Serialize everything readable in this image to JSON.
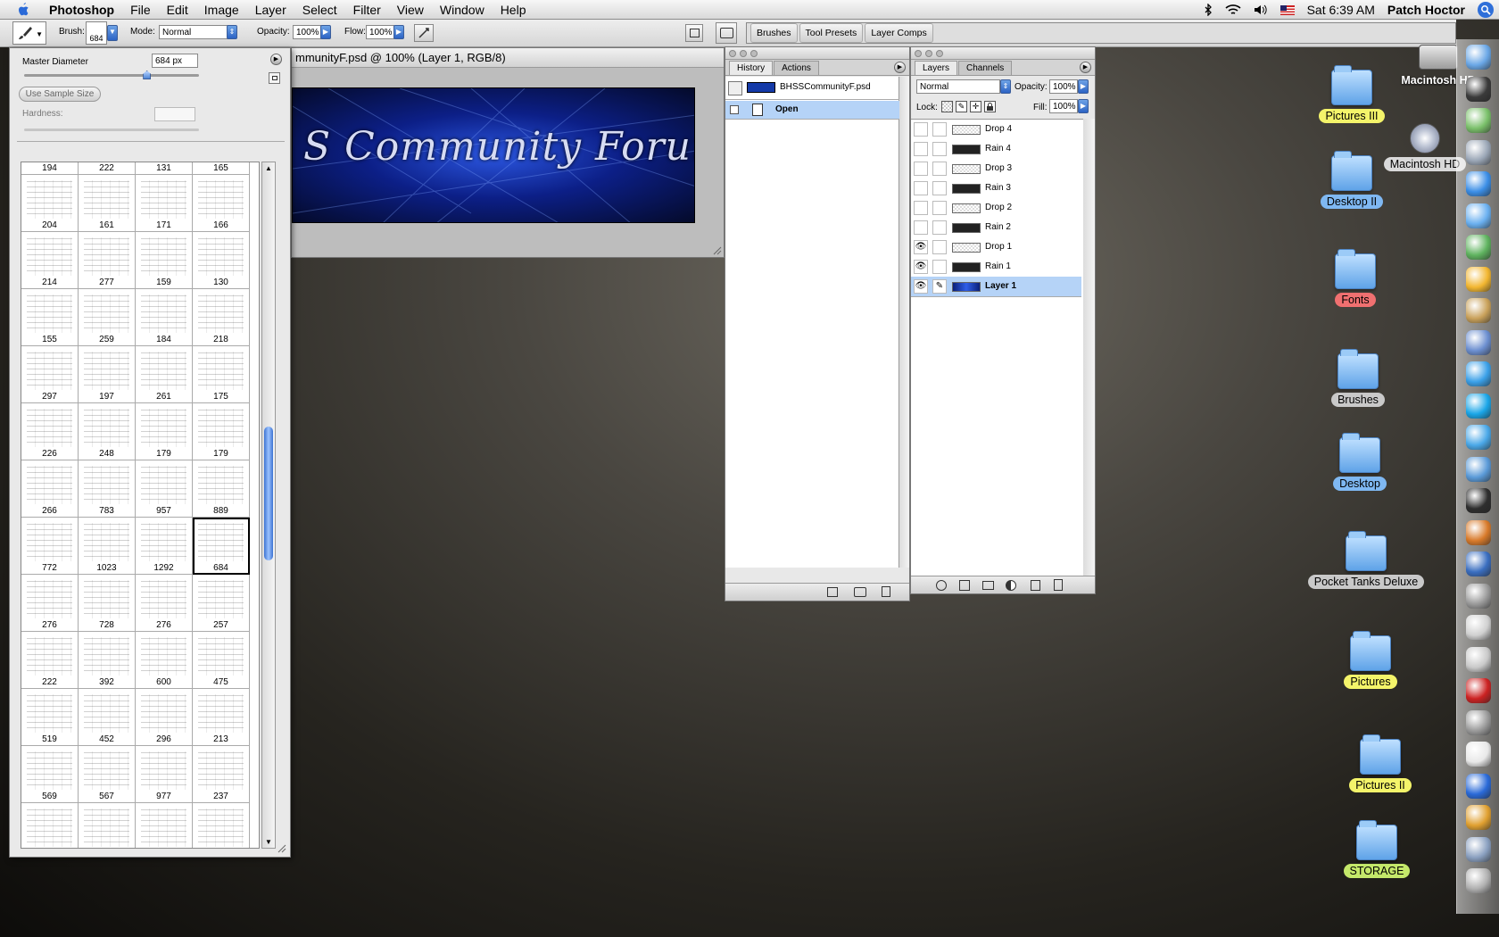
{
  "menubar": {
    "apple": "",
    "app_name": "Photoshop",
    "items": [
      "File",
      "Edit",
      "Image",
      "Layer",
      "Select",
      "Filter",
      "View",
      "Window",
      "Help"
    ],
    "clock": "Sat 6:39 AM",
    "user": "Patch Hoctor"
  },
  "options_bar": {
    "brush_label": "Brush:",
    "brush_size": "684",
    "mode_label": "Mode:",
    "mode_value": "Normal",
    "opacity_label": "Opacity:",
    "opacity_value": "100%",
    "flow_label": "Flow:",
    "flow_value": "100%",
    "well_tabs": [
      "Brushes",
      "Tool Presets",
      "Layer Comps"
    ]
  },
  "brush_picker": {
    "master_diameter_label": "Master Diameter",
    "master_diameter_value": "684 px",
    "slider_fraction": 0.7,
    "use_sample_size": "Use Sample Size",
    "hardness_label": "Hardness:",
    "hardness_value": "",
    "selected_brush": "684",
    "top_row": [
      "194",
      "222",
      "131",
      "165"
    ],
    "rows": [
      [
        "204",
        "161",
        "171",
        "166"
      ],
      [
        "214",
        "277",
        "159",
        "130"
      ],
      [
        "155",
        "259",
        "184",
        "218"
      ],
      [
        "297",
        "197",
        "261",
        "175"
      ],
      [
        "226",
        "248",
        "179",
        "179"
      ],
      [
        "266",
        "783",
        "957",
        "889"
      ],
      [
        "772",
        "1023",
        "1292",
        "684"
      ],
      [
        "276",
        "728",
        "276",
        "257"
      ],
      [
        "222",
        "392",
        "600",
        "475"
      ],
      [
        "519",
        "452",
        "296",
        "213"
      ],
      [
        "569",
        "567",
        "977",
        "237"
      ],
      [
        "",
        "",
        "",
        ""
      ]
    ]
  },
  "document": {
    "title": "mmunityF.psd @ 100% (Layer 1, RGB/8)",
    "banner_text": "S Community Forum"
  },
  "history_panel": {
    "tabs": [
      "History",
      "Actions"
    ],
    "snapshot_name": "BHSSCommunityF.psd",
    "states": [
      "Open"
    ]
  },
  "layers_panel": {
    "tabs": [
      "Layers",
      "Channels"
    ],
    "blend_mode": "Normal",
    "opacity_label": "Opacity:",
    "opacity_value": "100%",
    "lock_label": "Lock:",
    "fill_label": "Fill:",
    "fill_value": "100%",
    "layers": [
      {
        "name": "Drop 4",
        "visible": false,
        "thumb": "drop"
      },
      {
        "name": "Rain 4",
        "visible": false,
        "thumb": "rain"
      },
      {
        "name": "Drop 3",
        "visible": false,
        "thumb": "drop"
      },
      {
        "name": "Rain 3",
        "visible": false,
        "thumb": "rain"
      },
      {
        "name": "Drop 2",
        "visible": false,
        "thumb": "drop"
      },
      {
        "name": "Rain 2",
        "visible": false,
        "thumb": "rain"
      },
      {
        "name": "Drop 1",
        "visible": true,
        "thumb": "drop"
      },
      {
        "name": "Rain 1",
        "visible": true,
        "thumb": "rain"
      },
      {
        "name": "Layer 1",
        "visible": true,
        "thumb": "banner",
        "selected": true
      }
    ]
  },
  "desktop": {
    "icons": [
      {
        "label": "Macintosh HD",
        "color": "none",
        "kind": "drive"
      },
      {
        "label": "Pictures III",
        "color": "#f4f46a",
        "kind": "folder"
      },
      {
        "label": "Macintosh HD",
        "color": "#d9d9d9",
        "kind": "disc"
      },
      {
        "label": "Desktop II",
        "color": "#7fb8f2",
        "kind": "folder"
      },
      {
        "label": "Fonts",
        "color": "#f07070",
        "kind": "folder"
      },
      {
        "label": "Brushes",
        "color": "#c9c9c9",
        "kind": "folder"
      },
      {
        "label": "Desktop",
        "color": "#7fb8f2",
        "kind": "folder"
      },
      {
        "label": "Pocket Tanks Deluxe",
        "color": "#c9c9c9",
        "kind": "folder"
      },
      {
        "label": "Pictures",
        "color": "#f4f46a",
        "kind": "folder"
      },
      {
        "label": "Pictures II",
        "color": "#f4f46a",
        "kind": "folder"
      },
      {
        "label": "STORAGE",
        "color": "#c4e86a",
        "kind": "folder"
      }
    ]
  },
  "dock": {
    "items": [
      "finder-icon",
      "dashboard-icon",
      "grapher-icon",
      "network-icon",
      "safari-icon",
      "ichat-icon",
      "adium-icon",
      "sunflower-icon",
      "transmit-icon",
      "preview-icon",
      "ichat-av-icon",
      "skype-icon",
      "msn-icon",
      "itunes-icon",
      "activity-monitor-icon",
      "iphoto-icon",
      "imovie-icon",
      "dvd-player-icon",
      "ical-icon",
      "rosetta-icon",
      "flash-icon",
      "system-prefs-icon",
      "textedit-icon",
      "word-icon",
      "games-icon",
      "mail-icon",
      "trash-icon"
    ]
  }
}
